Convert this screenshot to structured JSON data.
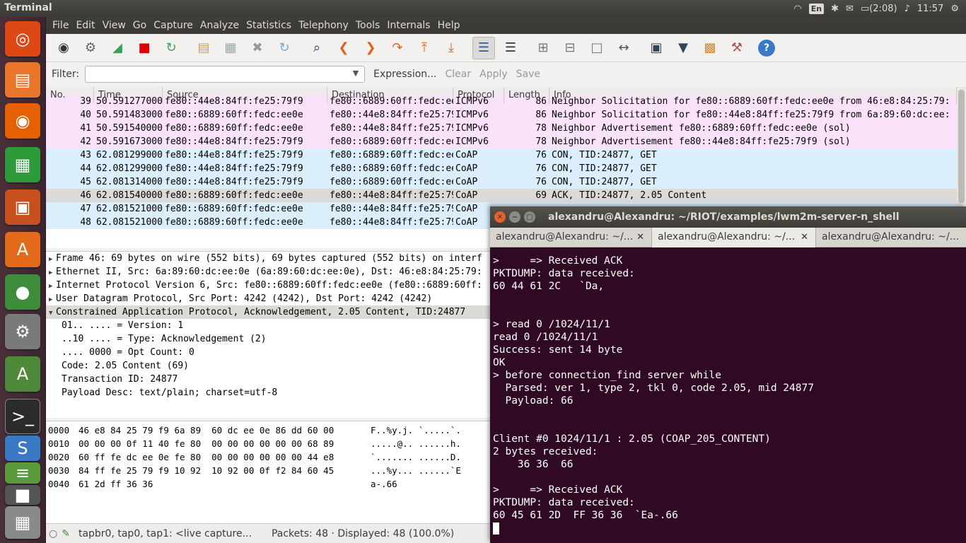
{
  "panel": {
    "title": "Terminal",
    "keyboard": "En",
    "battery": "(2:08)",
    "clock": "11:57"
  },
  "menu": [
    "File",
    "Edit",
    "View",
    "Go",
    "Capture",
    "Analyze",
    "Statistics",
    "Telephony",
    "Tools",
    "Internals",
    "Help"
  ],
  "filter": {
    "label": "Filter:",
    "value": "",
    "expression": "Expression...",
    "clear": "Clear",
    "apply": "Apply",
    "save": "Save"
  },
  "packet_list": {
    "columns": [
      "No.",
      "Time",
      "Source",
      "Destination",
      "Protocol",
      "Length",
      "Info"
    ],
    "rows": [
      {
        "no": "39",
        "time": "50.591277000",
        "src": "fe80::44e8:84ff:fe25:79f9",
        "dst": "fe80::6889:60ff:fedc:ee0e",
        "proto": "ICMPv6",
        "len": "86",
        "info": "Neighbor Solicitation for fe80::6889:60ff:fedc:ee0e from 46:e8:84:25:79:",
        "color": "#fbe2fb"
      },
      {
        "no": "40",
        "time": "50.591483000",
        "src": "fe80::6889:60ff:fedc:ee0e",
        "dst": "fe80::44e8:84ff:fe25:79f9",
        "proto": "ICMPv6",
        "len": "86",
        "info": "Neighbor Solicitation for fe80::44e8:84ff:fe25:79f9 from 6a:89:60:dc:ee:",
        "color": "#fbe2fb"
      },
      {
        "no": "41",
        "time": "50.591540000",
        "src": "fe80::6889:60ff:fedc:ee0e",
        "dst": "fe80::44e8:84ff:fe25:79f9",
        "proto": "ICMPv6",
        "len": "78",
        "info": "Neighbor Advertisement fe80::6889:60ff:fedc:ee0e (sol)",
        "color": "#fbe2fb"
      },
      {
        "no": "42",
        "time": "50.591673000",
        "src": "fe80::44e8:84ff:fe25:79f9",
        "dst": "fe80::6889:60ff:fedc:ee0e",
        "proto": "ICMPv6",
        "len": "78",
        "info": "Neighbor Advertisement fe80::44e8:84ff:fe25:79f9 (sol)",
        "color": "#fbe2fb"
      },
      {
        "no": "43",
        "time": "62.081299000",
        "src": "fe80::44e8:84ff:fe25:79f9",
        "dst": "fe80::6889:60ff:fedc:ee0e",
        "proto": "CoAP",
        "len": "76",
        "info": "CON, TID:24877, GET",
        "color": "#daeefc"
      },
      {
        "no": "44",
        "time": "62.081299000",
        "src": "fe80::44e8:84ff:fe25:79f9",
        "dst": "fe80::6889:60ff:fedc:ee0e",
        "proto": "CoAP",
        "len": "76",
        "info": "CON, TID:24877, GET",
        "color": "#daeefc"
      },
      {
        "no": "45",
        "time": "62.081314000",
        "src": "fe80::44e8:84ff:fe25:79f9",
        "dst": "fe80::6889:60ff:fedc:ee0e",
        "proto": "CoAP",
        "len": "76",
        "info": "CON, TID:24877, GET",
        "color": "#daeefc"
      },
      {
        "no": "46",
        "time": "62.081540000",
        "src": "fe80::6889:60ff:fedc:ee0e",
        "dst": "fe80::44e8:84ff:fe25:79f9",
        "proto": "CoAP",
        "len": "69",
        "info": "ACK, TID:24877, 2.05 Content",
        "color": "#dcdad7"
      },
      {
        "no": "47",
        "time": "62.081521000",
        "src": "fe80::6889:60ff:fedc:ee0e",
        "dst": "fe80::44e8:84ff:fe25:79f9",
        "proto": "CoAP",
        "len": "",
        "info": "",
        "color": "#daeefc"
      },
      {
        "no": "48",
        "time": "62.081521000",
        "src": "fe80::6889:60ff:fedc:ee0e",
        "dst": "fe80::44e8:84ff:fe25:79f9",
        "proto": "CoAP",
        "len": "",
        "info": "",
        "color": "#daeefc"
      }
    ]
  },
  "details": [
    {
      "text": "Frame 46: 69 bytes on wire (552 bits), 69 bytes captured (552 bits) on interf",
      "type": "collapsed"
    },
    {
      "text": "Ethernet II, Src: 6a:89:60:dc:ee:0e (6a:89:60:dc:ee:0e), Dst: 46:e8:84:25:79:",
      "type": "collapsed"
    },
    {
      "text": "Internet Protocol Version 6, Src: fe80::6889:60ff:fedc:ee0e (fe80::6889:60ff:",
      "type": "collapsed"
    },
    {
      "text": "User Datagram Protocol, Src Port: 4242 (4242), Dst Port: 4242 (4242)",
      "type": "collapsed"
    },
    {
      "text": "Constrained Application Protocol, Acknowledgement, 2.05 Content, TID:24877",
      "type": "expanded"
    },
    {
      "text": "01.. .... = Version: 1",
      "type": "sub"
    },
    {
      "text": "..10 .... = Type: Acknowledgement (2)",
      "type": "sub"
    },
    {
      "text": ".... 0000 = Opt Count: 0",
      "type": "sub"
    },
    {
      "text": "Code: 2.05 Content (69)",
      "type": "sub"
    },
    {
      "text": "Transaction ID: 24877",
      "type": "sub"
    },
    {
      "text": "Payload Desc: text/plain; charset=utf-8",
      "type": "sub"
    }
  ],
  "hex": [
    {
      "off": "0000",
      "bytes": "46 e8 84 25 79 f9 6a 89  60 dc ee 0e 86 dd 60 00",
      "ascii": "F..%y.j. `.....`."
    },
    {
      "off": "0010",
      "bytes": "00 00 00 0f 11 40 fe 80  00 00 00 00 00 00 68 89",
      "ascii": ".....@.. ......h."
    },
    {
      "off": "0020",
      "bytes": "60 ff fe dc ee 0e fe 80  00 00 00 00 00 00 44 e8",
      "ascii": "`....... ......D."
    },
    {
      "off": "0030",
      "bytes": "84 ff fe 25 79 f9 10 92  10 92 00 0f f2 84 60 45",
      "ascii": "...%y... ......`E"
    },
    {
      "off": "0040",
      "bytes": "61 2d ff 36 36",
      "ascii": "a-.66"
    }
  ],
  "status": {
    "interfaces": "tapbr0, tap0, tap1: <live capture...",
    "packets": "Packets: 48 · Displayed: 48 (100.0%)"
  },
  "terminal": {
    "title": "alexandru@Alexandru: ~/RIOT/examples/lwm2m-server-n_shell",
    "tabs": [
      "alexandru@Alexandru: ~/...",
      "alexandru@Alexandru: ~/...",
      "alexandru@Alexandru: ~/..."
    ],
    "output": ">     => Received ACK\nPKTDUMP: data received:\n60 44 61 2C   `Da,\n\n\n> read 0 /1024/11/1\nread 0 /1024/11/1\nSuccess: sent 14 byte\nOK\n> before connection_find server while\n  Parsed: ver 1, type 2, tkl 0, code 2.05, mid 24877\n  Payload: 66\n\n\nClient #0 1024/11/1 : 2.05 (COAP_205_CONTENT)\n2 bytes received:\n    36 36  66\n\n>     => Received ACK\nPKTDUMP: data received:\n60 45 61 2D  FF 36 36  `Ea-.66\n"
  }
}
